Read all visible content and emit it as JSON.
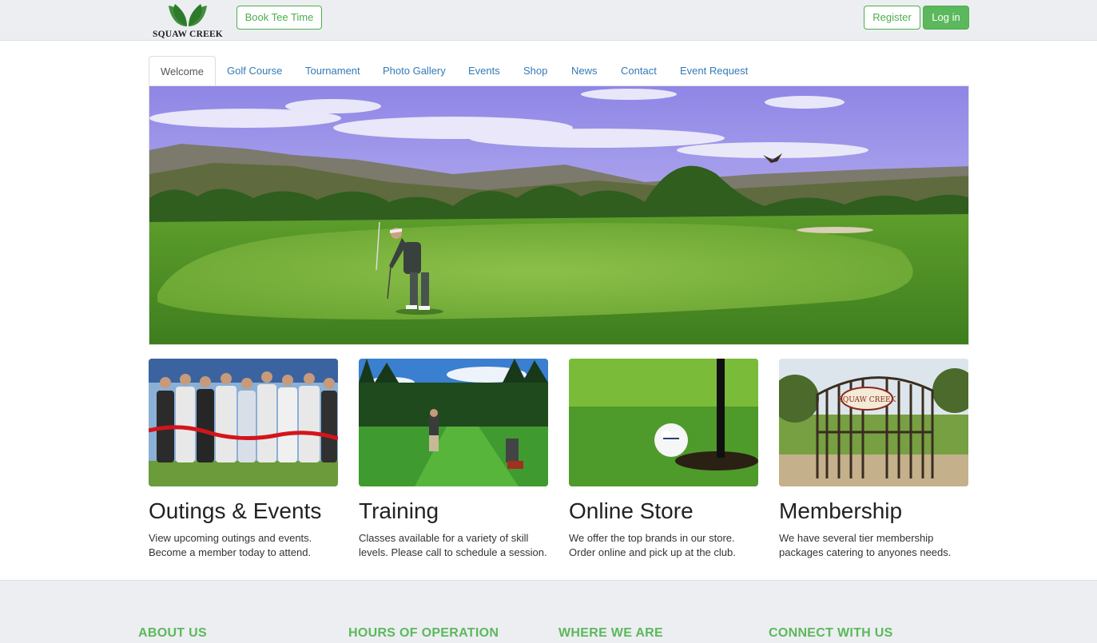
{
  "header": {
    "logo_text": "SQUAW CREEK",
    "book_tee_time": "Book Tee Time",
    "register": "Register",
    "login": "Log in"
  },
  "tabs": [
    {
      "label": "Welcome",
      "active": true
    },
    {
      "label": "Golf Course"
    },
    {
      "label": "Tournament"
    },
    {
      "label": "Photo Gallery"
    },
    {
      "label": "Events"
    },
    {
      "label": "Shop"
    },
    {
      "label": "News"
    },
    {
      "label": "Contact"
    },
    {
      "label": "Event Request"
    }
  ],
  "cards": [
    {
      "title": "Outings & Events",
      "text": "View upcoming outings and events. Become a member today to attend."
    },
    {
      "title": "Training",
      "text": "Classes available for a variety of skill levels. Please call to schedule a session."
    },
    {
      "title": "Online Store",
      "text": "We offer the top brands in our store. Order online and pick up at the club."
    },
    {
      "title": "Membership",
      "text": "We have several tier membership packages catering to anyones needs."
    }
  ],
  "footer": {
    "about": "ABOUT US",
    "hours": "HOURS OF OPERATION",
    "where": "WHERE WE ARE",
    "connect": "CONNECT WITH US"
  },
  "colors": {
    "accent_green": "#5cb85c",
    "link_blue": "#337ab7",
    "topbar_bg": "#eceef1"
  },
  "images": {
    "logo": "leaf-logo-icon",
    "hero": "golfer-putting-on-green",
    "card1": "ribbon-cutting-group-photo",
    "card2": "golfer-on-fairway",
    "card3": "golf-ball-near-hole",
    "card4": "squaw-creek-gate"
  },
  "gate_sign_text": "SQUAW CREEK"
}
